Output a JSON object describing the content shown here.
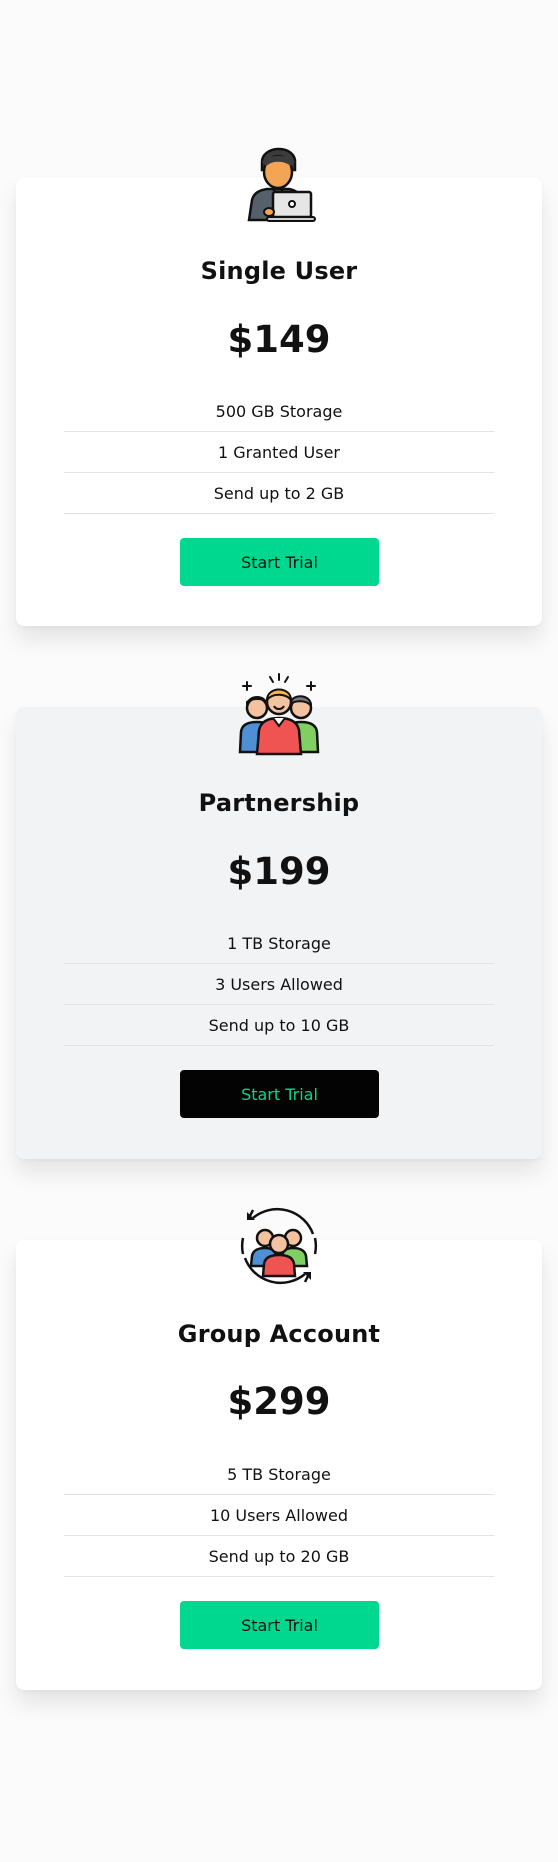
{
  "plans": [
    {
      "icon": "user-laptop-icon",
      "title": "Single User",
      "price": "$149",
      "features": [
        "500 GB Storage",
        "1 Granted User",
        "Send up to 2 GB"
      ],
      "button_label": "Start Trial",
      "button_style": "green"
    },
    {
      "icon": "team-celebrate-icon",
      "title": "Partnership",
      "price": "$199",
      "features": [
        "1 TB Storage",
        "3 Users Allowed",
        "Send up to 10 GB"
      ],
      "button_label": "Start Trial",
      "button_style": "dark"
    },
    {
      "icon": "group-cycle-icon",
      "title": "Group Account",
      "price": "$299",
      "features": [
        "5 TB Storage",
        "10 Users Allowed",
        "Send up to 20 GB"
      ],
      "button_label": "Start Trial",
      "button_style": "green"
    }
  ],
  "colors": {
    "accent_green": "#00d890",
    "dark_button": "#030303",
    "card_alt_bg": "#f2f3f5",
    "card_bg": "#ffffff",
    "page_bg": "#fbfbfb"
  }
}
